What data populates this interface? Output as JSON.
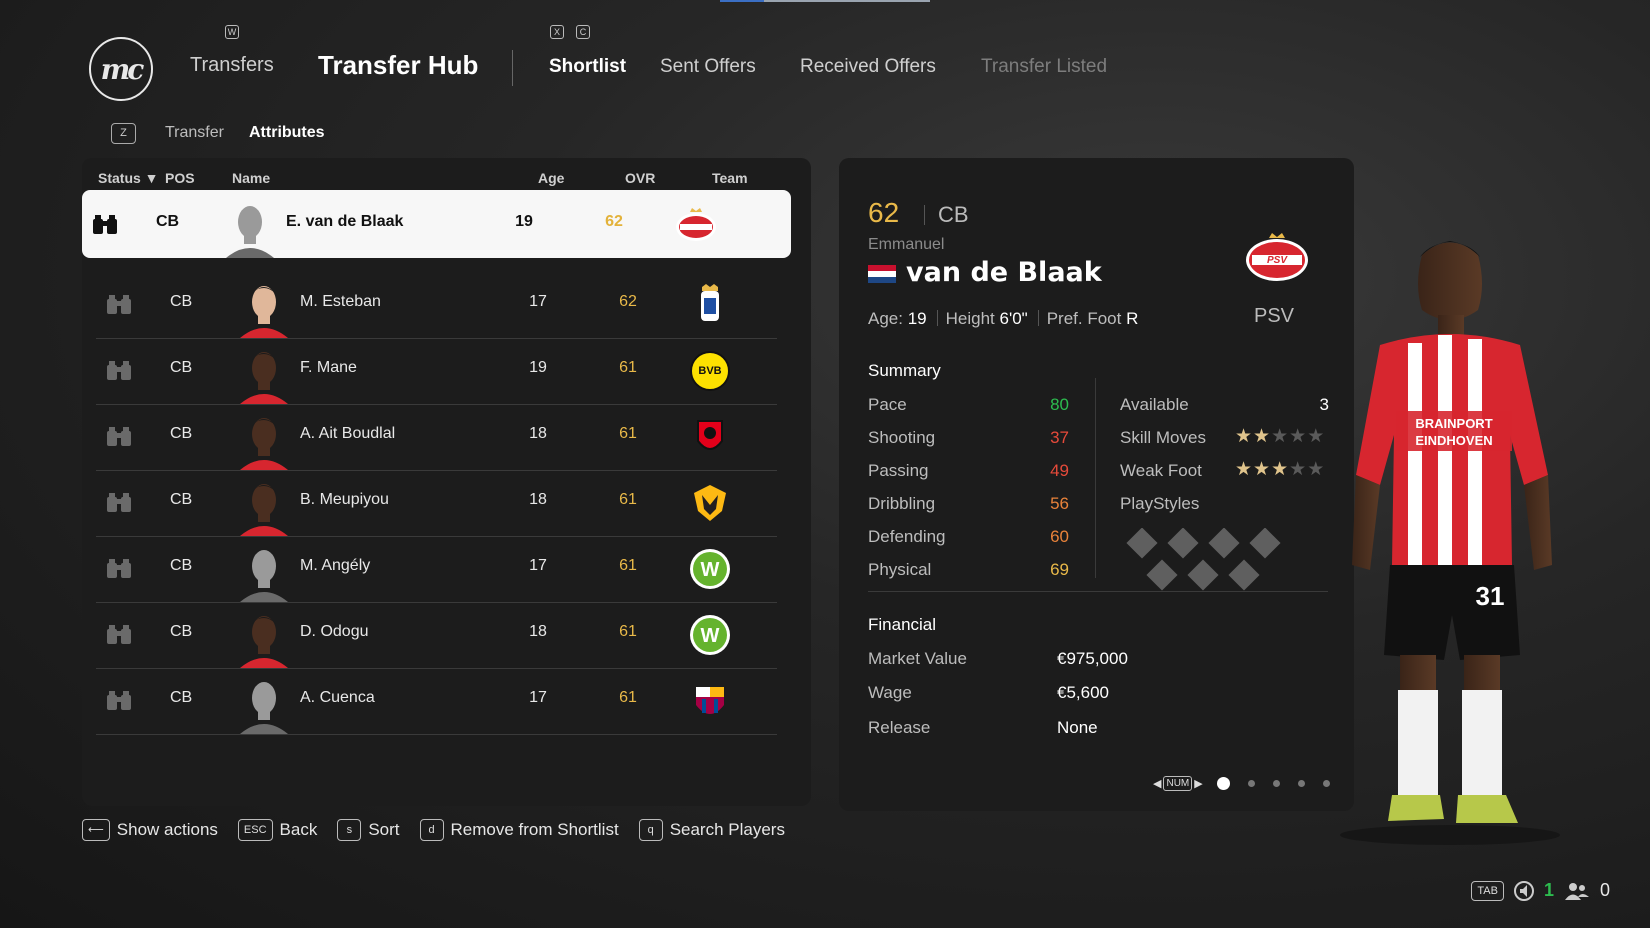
{
  "header": {
    "logo_text": "mc",
    "nav_transfers": "Transfers",
    "nav_title": "Transfer Hub",
    "key_w": "W",
    "key_x": "X",
    "key_c": "C",
    "tabs": [
      {
        "label": "Shortlist",
        "state": "active"
      },
      {
        "label": "Sent Offers",
        "state": "normal"
      },
      {
        "label": "Received Offers",
        "state": "normal"
      },
      {
        "label": "Transfer Listed",
        "state": "disabled"
      }
    ],
    "subkey": "Z",
    "subtabs": [
      {
        "label": "Transfer",
        "state": "normal"
      },
      {
        "label": "Attributes",
        "state": "active"
      }
    ]
  },
  "table": {
    "columns": {
      "status": "Status ▼",
      "pos": "POS",
      "name": "Name",
      "age": "Age",
      "ovr": "OVR",
      "team": "Team"
    },
    "rows": [
      {
        "pos": "CB",
        "name": "E. van de Blaak",
        "age": "19",
        "ovr": "62",
        "team": "PSV",
        "face": "silhouette",
        "selected": true
      },
      {
        "pos": "CB",
        "name": "M. Esteban",
        "age": "17",
        "ovr": "62",
        "team": "Real Oviedo",
        "face": "light"
      },
      {
        "pos": "CB",
        "name": "F. Mane",
        "age": "19",
        "ovr": "61",
        "team": "BVB 09",
        "face": "dark"
      },
      {
        "pos": "CB",
        "name": "A. Ait Boudlal",
        "age": "18",
        "ovr": "61",
        "team": "Stade Rennais",
        "face": "dark"
      },
      {
        "pos": "CB",
        "name": "B. Meupiyou",
        "age": "18",
        "ovr": "61",
        "team": "Wolves",
        "face": "dark"
      },
      {
        "pos": "CB",
        "name": "M. Angély",
        "age": "17",
        "ovr": "61",
        "team": "VfL Wolfsburg",
        "face": "silhouette"
      },
      {
        "pos": "CB",
        "name": "D. Odogu",
        "age": "18",
        "ovr": "61",
        "team": "VfL Wolfsburg",
        "face": "dark"
      },
      {
        "pos": "CB",
        "name": "A. Cuenca",
        "age": "17",
        "ovr": "61",
        "team": "FC Barcelona",
        "face": "silhouette"
      }
    ]
  },
  "detail": {
    "ovr": "62",
    "pos": "CB",
    "first_name": "Emmanuel",
    "last_name": "van de Blaak",
    "team": "PSV",
    "crest_text": "PSV",
    "age_label": "Age:",
    "age": "19",
    "height_label": "Height",
    "height": "6'0\"",
    "foot_label": "Pref. Foot",
    "foot": "R",
    "summary_title": "Summary",
    "stats": [
      {
        "label": "Pace",
        "value": "80",
        "color": "green"
      },
      {
        "label": "Shooting",
        "value": "37",
        "color": "red"
      },
      {
        "label": "Passing",
        "value": "49",
        "color": "red"
      },
      {
        "label": "Dribbling",
        "value": "56",
        "color": "orange"
      },
      {
        "label": "Defending",
        "value": "60",
        "color": "orange"
      },
      {
        "label": "Physical",
        "value": "69",
        "color": "yellow"
      }
    ],
    "available_label": "Available",
    "available": "3",
    "skill_label": "Skill Moves",
    "skill_stars": 2,
    "weak_label": "Weak Foot",
    "weak_stars": 3,
    "playstyles_label": "PlayStyles",
    "financial_title": "Financial",
    "financial": [
      {
        "label": "Market Value",
        "value": "€975,000"
      },
      {
        "label": "Wage",
        "value": "€5,600"
      },
      {
        "label": "Release",
        "value": "None"
      }
    ],
    "pager_key": "NUM",
    "page_count": 5,
    "page_current": 1
  },
  "actions": [
    {
      "key": "⟵",
      "label": "Show actions"
    },
    {
      "key": "ESC",
      "label": "Back"
    },
    {
      "key": "s",
      "label": "Sort"
    },
    {
      "key": "d",
      "label": "Remove from Shortlist"
    },
    {
      "key": "q",
      "label": "Search Players"
    }
  ],
  "hud": {
    "key": "TAB",
    "count_a": "1",
    "count_b": "0"
  },
  "player_kit": {
    "sponsor_line1": "BRAINPORT",
    "sponsor_line2": "EINDHOVEN",
    "number": "31"
  },
  "colors": {
    "accent_green": "#17b23e",
    "ovr_yellow": "#e9b949",
    "stat_red": "#e64a3a",
    "psv_red": "#d7262f"
  }
}
